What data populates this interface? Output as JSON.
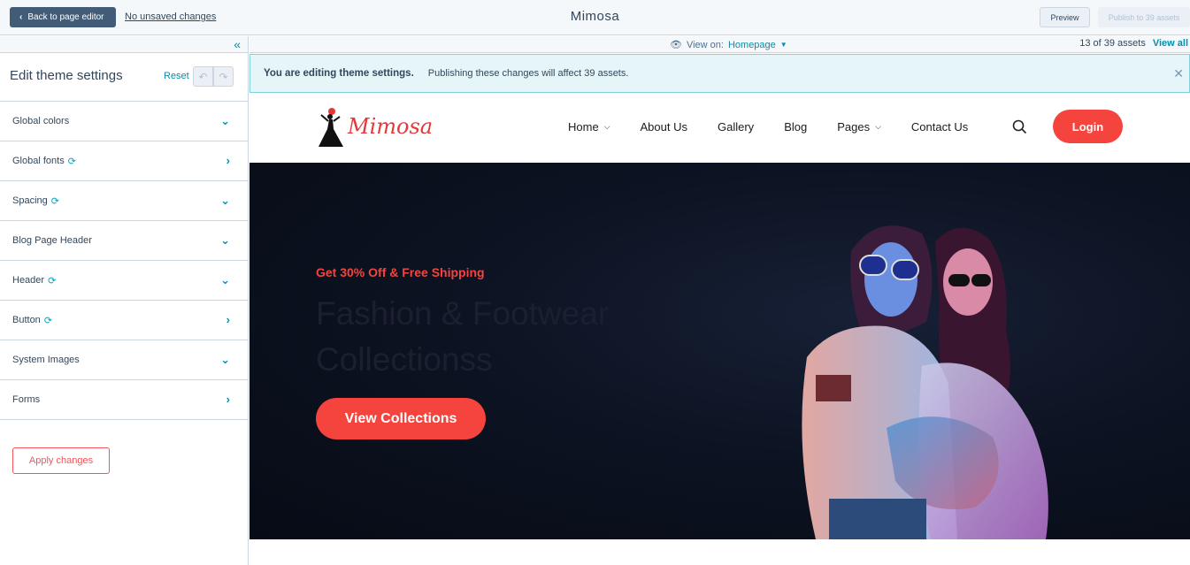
{
  "topbar": {
    "back_label": "Back to page editor",
    "unsaved_label": "No unsaved changes",
    "site_title": "Mimosa",
    "preview_label": "Preview",
    "publish_label": "Publish to 39 assets"
  },
  "sidebar": {
    "title": "Edit theme settings",
    "reset_label": "Reset",
    "items": [
      {
        "label": "Global colors",
        "sync": false,
        "arrow": "⌄"
      },
      {
        "label": "Global fonts",
        "sync": true,
        "arrow": "›"
      },
      {
        "label": "Spacing",
        "sync": true,
        "arrow": "⌄"
      },
      {
        "label": "Blog Page Header",
        "sync": false,
        "arrow": "⌄"
      },
      {
        "label": "Header",
        "sync": true,
        "arrow": "⌄"
      },
      {
        "label": "Button",
        "sync": true,
        "arrow": "›"
      },
      {
        "label": "System Images",
        "sync": false,
        "arrow": "⌄"
      },
      {
        "label": "Forms",
        "sync": false,
        "arrow": "›"
      }
    ],
    "apply_label": "Apply changes"
  },
  "viewbar": {
    "view_on_label": "View on:",
    "page": "Homepage",
    "asset_count": "13 of 39 assets",
    "view_all": "View all"
  },
  "banner": {
    "bold": "You are editing theme settings.",
    "text": "Publishing these changes will affect 39 assets."
  },
  "site": {
    "logo_text": "Mimosa",
    "nav": [
      "Home",
      "About Us",
      "Gallery",
      "Blog",
      "Pages",
      "Contact Us"
    ],
    "login_label": "Login",
    "promo": "Get 30% Off & Free Shipping",
    "headline_1": "Fashion & Footwear",
    "headline_2": "Collectionss",
    "cta_label": "View Collections"
  },
  "colors": {
    "accent": "#f4443d",
    "link": "#0091ae",
    "back_button": "#425b76"
  }
}
